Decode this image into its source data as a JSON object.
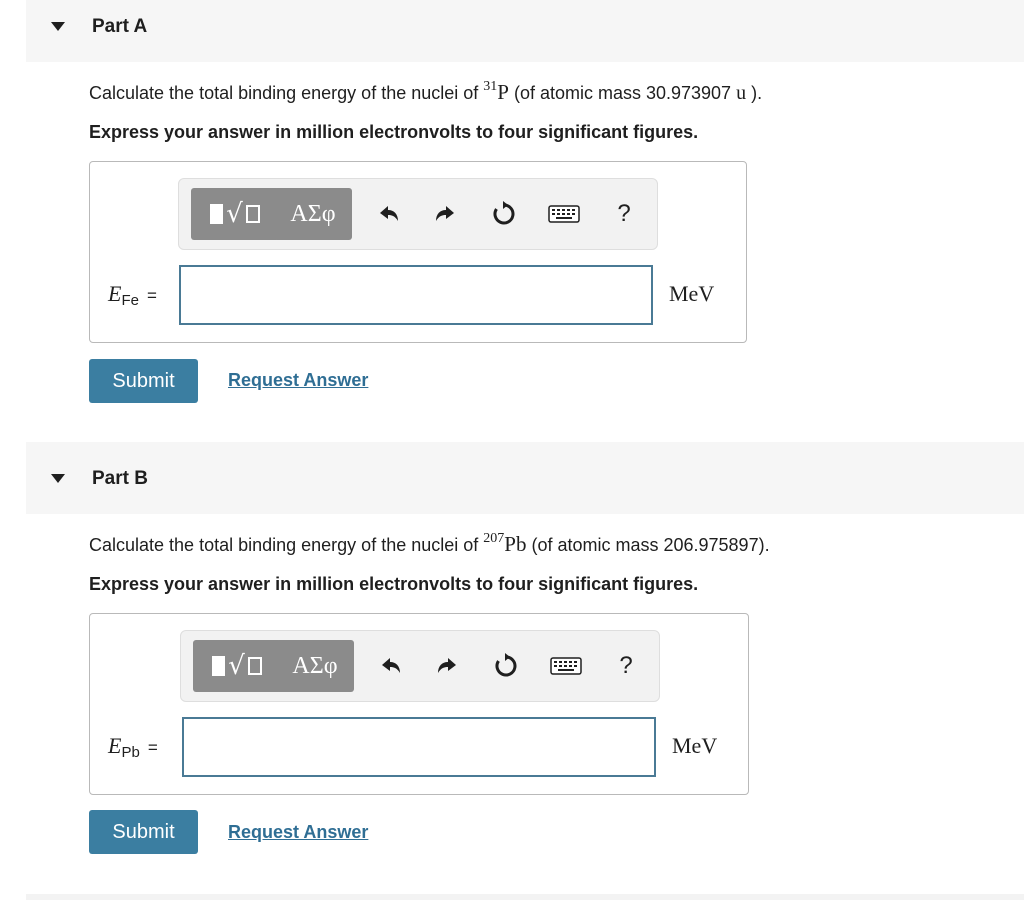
{
  "parts": [
    {
      "title": "Part A",
      "question_pre": "Calculate the total binding energy of the nuclei of ",
      "isotope_mass_number": "31",
      "isotope_symbol": "P",
      "question_post": " (of atomic mass 30.973907 ",
      "mass_unit": "u",
      "question_end": " ).",
      "instruction": "Express your answer in million electronvolts to four significant figures.",
      "variable": "E",
      "variable_sub": "Fe",
      "equals": "=",
      "input_value": "",
      "unit": "MeV",
      "submit_label": "Submit",
      "request_label": "Request Answer"
    },
    {
      "title": "Part B",
      "question_pre": "Calculate the total binding energy of the nuclei of ",
      "isotope_mass_number": "207",
      "isotope_symbol": "Pb",
      "question_post": " (of atomic mass 206.975897).",
      "mass_unit": "",
      "question_end": "",
      "instruction": "Express your answer in million electronvolts to four significant figures.",
      "variable": "E",
      "variable_sub": "Pb",
      "equals": "=",
      "input_value": "",
      "unit": "MeV",
      "submit_label": "Submit",
      "request_label": "Request Answer"
    }
  ],
  "toolbar": {
    "greek_label": "ΑΣφ",
    "help_label": "?",
    "icons": [
      "templates-icon",
      "greek-letters-icon",
      "undo-icon",
      "redo-icon",
      "reset-icon",
      "keyboard-icon",
      "help-icon"
    ]
  },
  "colors": {
    "submit_bg": "#3b7ea1",
    "link": "#2f6e94",
    "input_border": "#4a7a95",
    "toolbar_button": "#8b8b8b",
    "header_bg": "#f6f6f6"
  }
}
